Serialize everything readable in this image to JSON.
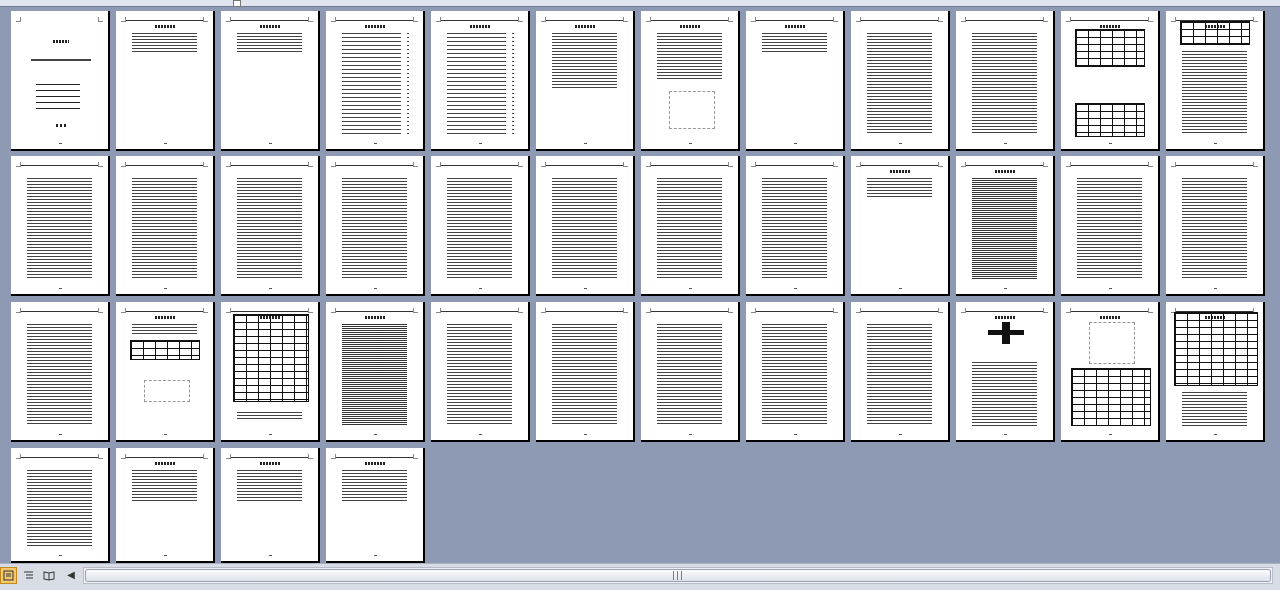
{
  "window": {
    "view_mode": "thumbnail-pages"
  },
  "colors": {
    "workspace": "#8e9ab3",
    "statusbar": "#d8dce4",
    "active_view": "#f6c86d"
  },
  "pages": [
    {
      "kind": "cover"
    },
    {
      "kind": "sparse"
    },
    {
      "kind": "sparse"
    },
    {
      "kind": "toc"
    },
    {
      "kind": "toc"
    },
    {
      "kind": "half"
    },
    {
      "kind": "figure"
    },
    {
      "kind": "sparse"
    },
    {
      "kind": "text"
    },
    {
      "kind": "text"
    },
    {
      "kind": "table2"
    },
    {
      "kind": "tabletop"
    },
    {
      "kind": "text"
    },
    {
      "kind": "text"
    },
    {
      "kind": "text"
    },
    {
      "kind": "text"
    },
    {
      "kind": "text"
    },
    {
      "kind": "text"
    },
    {
      "kind": "text"
    },
    {
      "kind": "text"
    },
    {
      "kind": "sparse"
    },
    {
      "kind": "dense"
    },
    {
      "kind": "text"
    },
    {
      "kind": "text"
    },
    {
      "kind": "text"
    },
    {
      "kind": "tablemid"
    },
    {
      "kind": "bigtable"
    },
    {
      "kind": "dense"
    },
    {
      "kind": "text"
    },
    {
      "kind": "text"
    },
    {
      "kind": "text"
    },
    {
      "kind": "text"
    },
    {
      "kind": "text"
    },
    {
      "kind": "darkfig"
    },
    {
      "kind": "figtable"
    },
    {
      "kind": "tabletopbig"
    },
    {
      "kind": "text"
    },
    {
      "kind": "half"
    },
    {
      "kind": "half"
    },
    {
      "kind": "half"
    }
  ],
  "statusbar": {
    "view_buttons": [
      {
        "name": "normal-view-icon",
        "glyph": "▣",
        "active": true
      },
      {
        "name": "outline-view-icon",
        "glyph": "☷",
        "active": false
      },
      {
        "name": "reading-view-icon",
        "glyph": "📖",
        "active": false
      }
    ],
    "scroll_left_glyph": "◀",
    "thumb_grip": "|||"
  }
}
